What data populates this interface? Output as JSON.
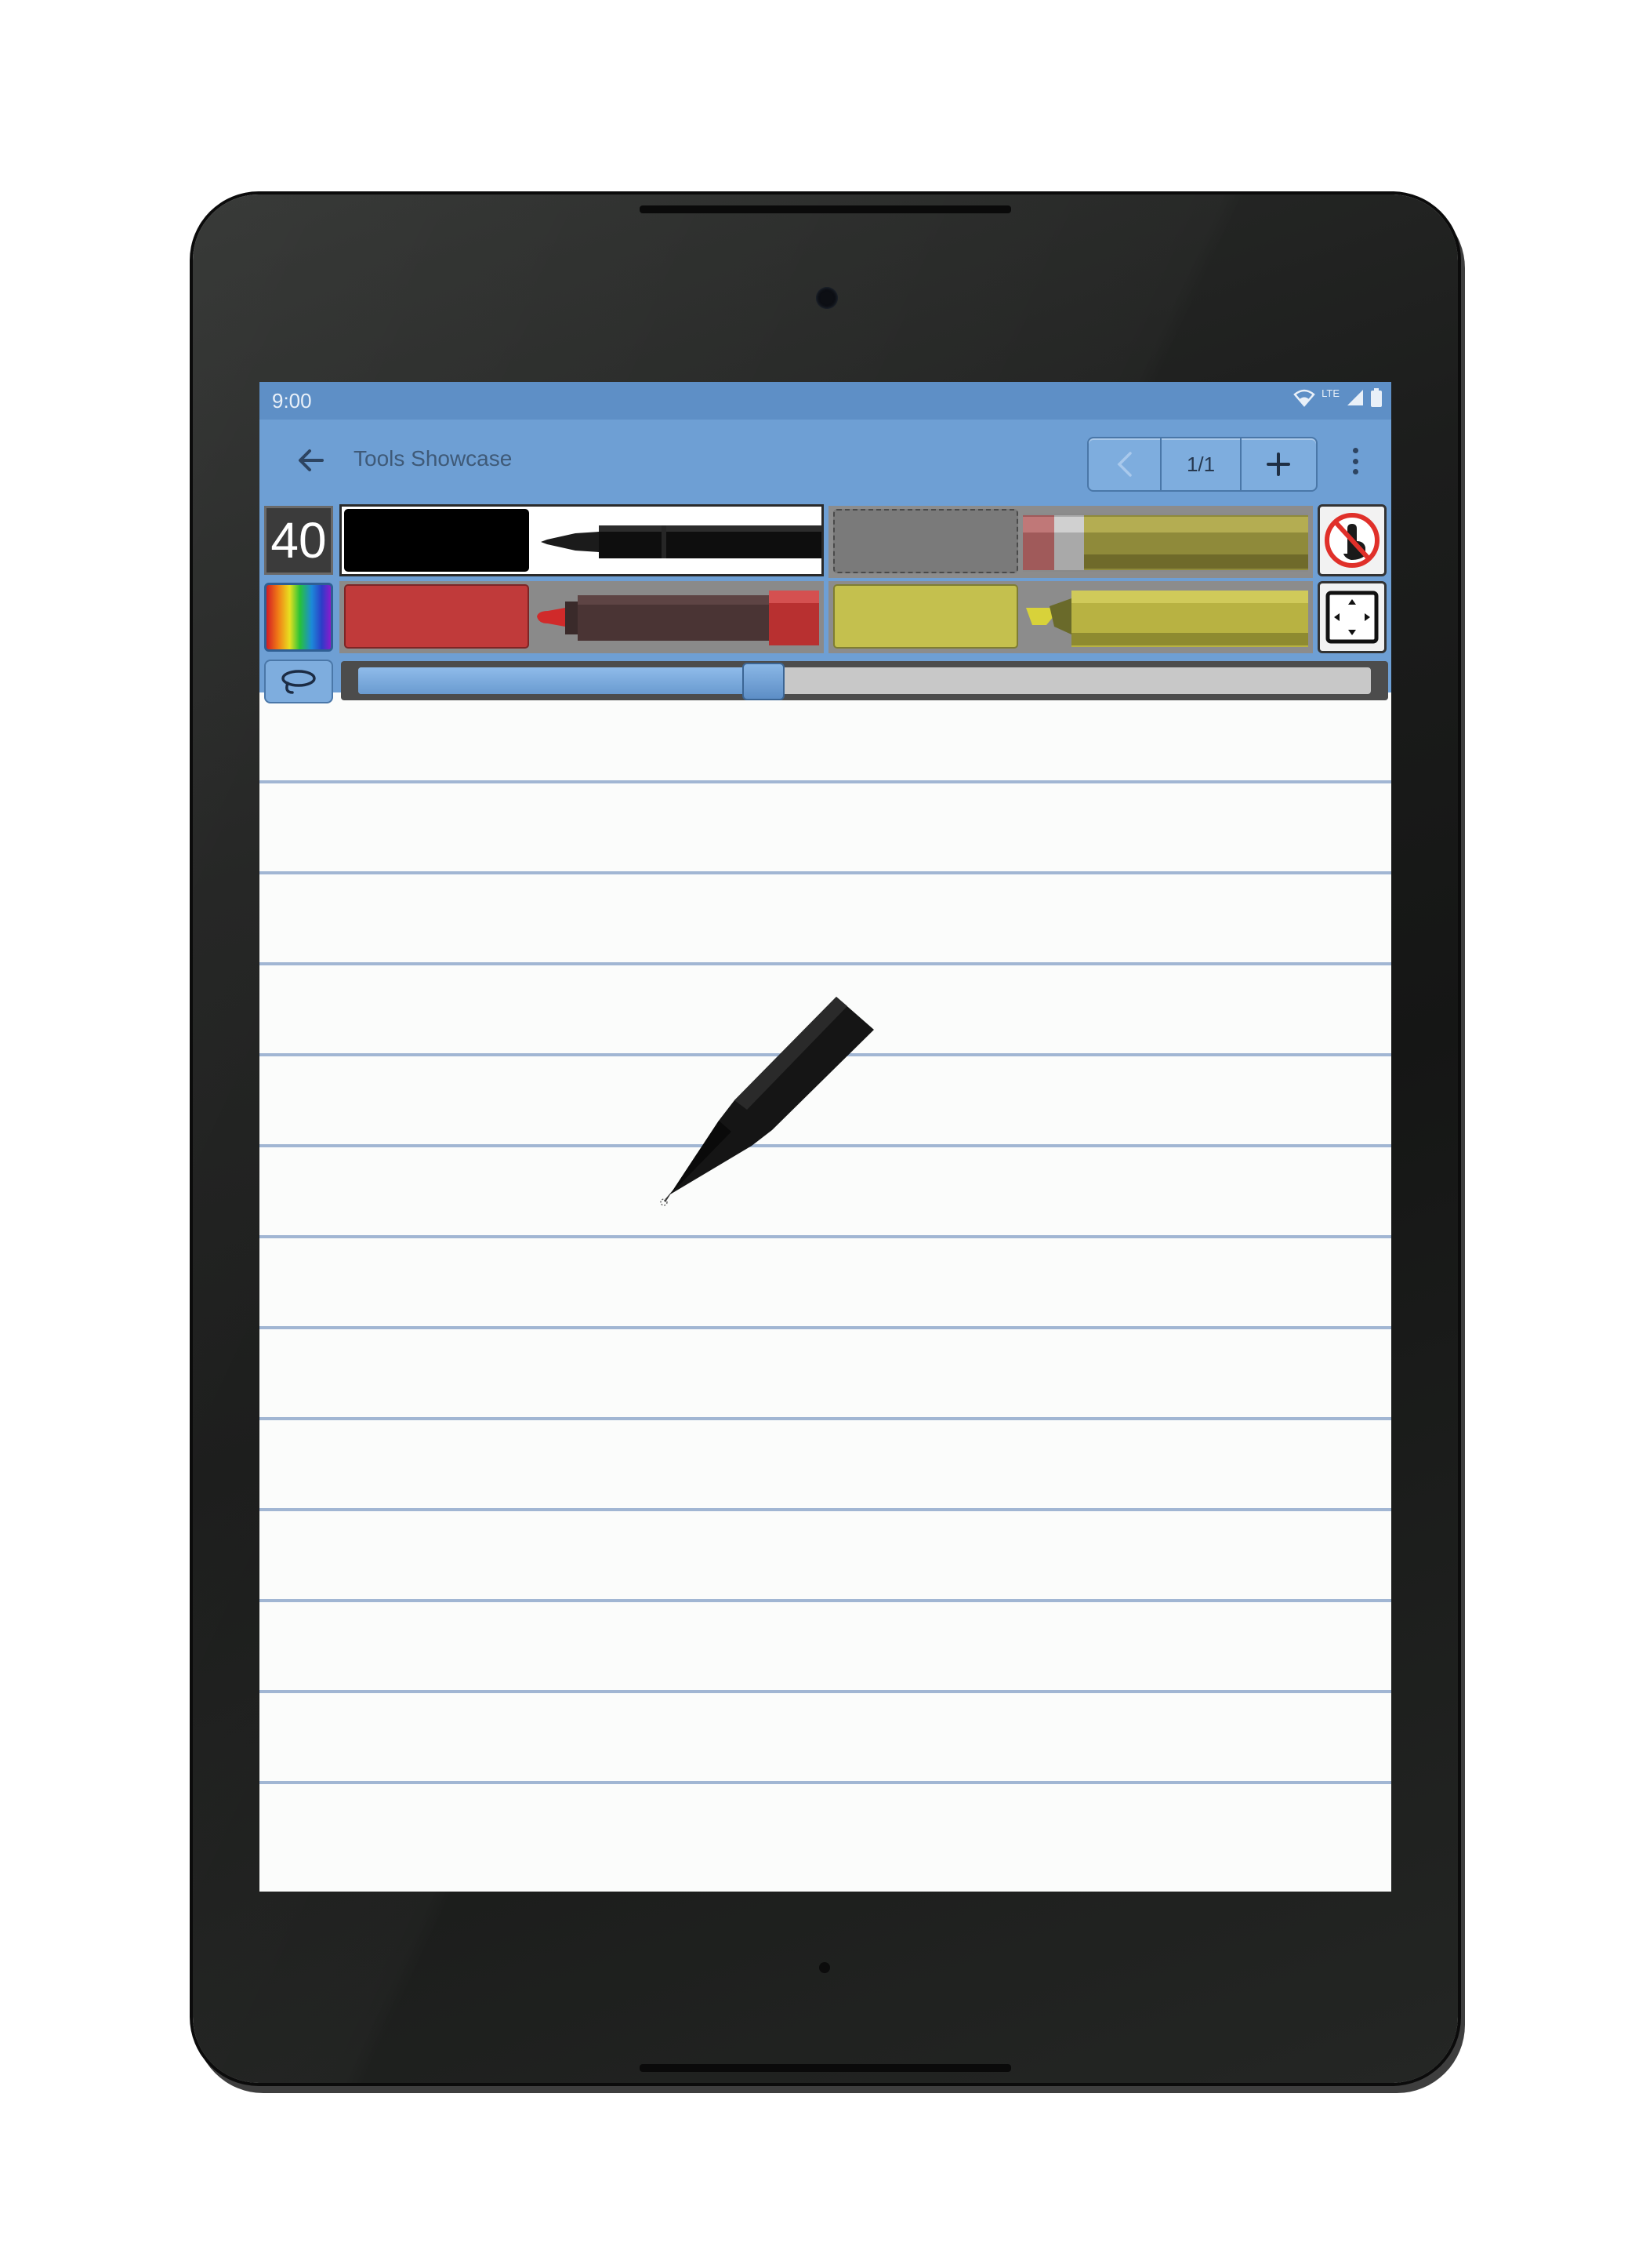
{
  "status_bar": {
    "time": "9:00",
    "network": "LTE",
    "icons": [
      "wifi-icon",
      "signal-icon",
      "battery-icon"
    ]
  },
  "app_bar": {
    "back_icon": "arrow-left-icon",
    "title": "Tools Showcase",
    "pager": {
      "prev_icon": "chevron-left-icon",
      "page_indicator": "1/1",
      "add_icon": "plus-icon"
    },
    "menu_icon": "more-vertical-icon"
  },
  "toolbar": {
    "size_value": "40",
    "color_picker_icon": "rainbow-palette-icon",
    "tools": [
      {
        "name": "black pen",
        "color": "#000000",
        "tool_icon": "pen-icon",
        "selected": true
      },
      {
        "name": "gray pencil",
        "color": "#7a7a7a",
        "tool_icon": "pencil-icon",
        "selected": false,
        "dashed_outline": true
      },
      {
        "name": "red marker",
        "color": "#c03a3a",
        "tool_icon": "marker-icon",
        "selected": false
      },
      {
        "name": "yellow highlighter",
        "color": "#c4c04e",
        "tool_icon": "highlighter-icon",
        "selected": false
      }
    ],
    "side_buttons": [
      "touch-draw-disabled-icon",
      "fit-screen-icon"
    ],
    "lasso_icon": "lasso-icon",
    "stroke_slider": {
      "value_fraction": 0.4
    }
  },
  "canvas": {
    "ruled_lines": 12,
    "cursor_icon": "pen-cursor-icon"
  },
  "colors": {
    "accent": "#6e9fd4",
    "status_bar": "#5e8fc6",
    "rule_line": "#a1b6d3",
    "paper": "#fbfcfb"
  }
}
